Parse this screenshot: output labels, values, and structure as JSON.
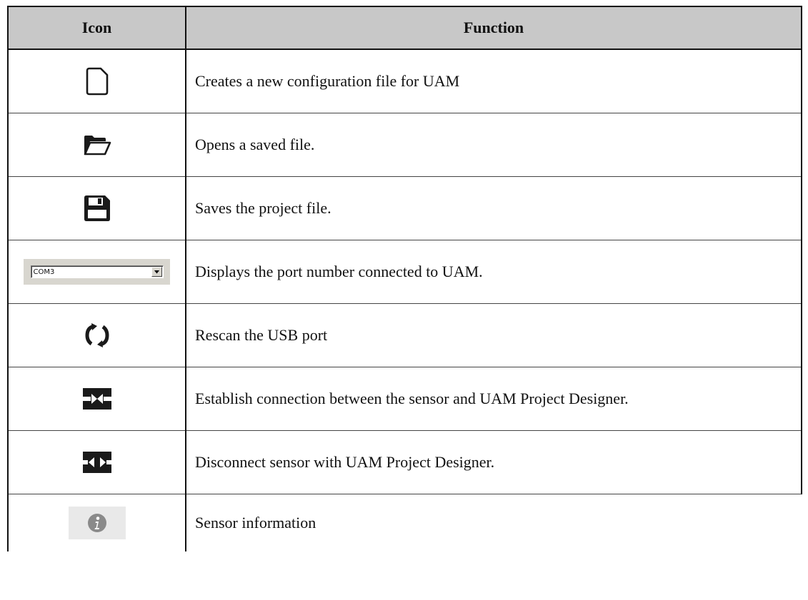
{
  "table": {
    "headers": {
      "icon": "Icon",
      "function": "Function"
    },
    "rows": [
      {
        "icon": "new-file-icon",
        "function": "Creates a new configuration file for UAM"
      },
      {
        "icon": "open-folder-icon",
        "function": "Opens a saved file."
      },
      {
        "icon": "save-disk-icon",
        "function": "Saves the project file."
      },
      {
        "icon": "com-port-dropdown",
        "function": "Displays the port number connected to UAM.",
        "combo_value": "COM3"
      },
      {
        "icon": "rescan-icon",
        "function": "Rescan the USB port"
      },
      {
        "icon": "connect-icon",
        "function": "Establish connection between the sensor and UAM Project Designer."
      },
      {
        "icon": "disconnect-icon",
        "function": "Disconnect sensor with UAM Project Designer."
      },
      {
        "icon": "info-icon",
        "function": "Sensor information"
      }
    ]
  },
  "colors": {
    "header_bg": "#c8c8c8",
    "border": "#111111",
    "icon_dark": "#1a1a1a",
    "info_gray": "#8a8a8a"
  }
}
